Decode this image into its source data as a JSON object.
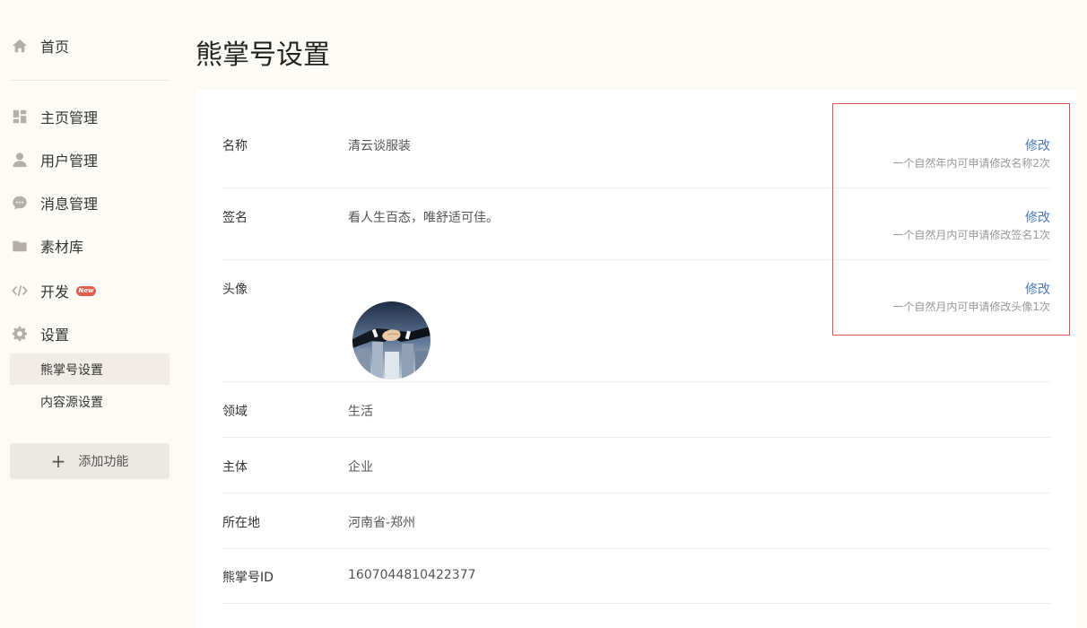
{
  "sidebar": {
    "home": {
      "label": "首页",
      "icon": "home-icon"
    },
    "items": [
      {
        "label": "主页管理",
        "icon": "dashboard-icon"
      },
      {
        "label": "用户管理",
        "icon": "user-icon"
      },
      {
        "label": "消息管理",
        "icon": "chat-icon"
      },
      {
        "label": "素材库",
        "icon": "folder-icon"
      },
      {
        "label": "开发",
        "icon": "code-icon",
        "badge": "New"
      },
      {
        "label": "设置",
        "icon": "gear-icon"
      }
    ],
    "sub_items": [
      {
        "label": "熊掌号设置",
        "active": true
      },
      {
        "label": "内容源设置",
        "active": false
      }
    ],
    "add_button": "添加功能"
  },
  "page": {
    "title": "熊掌号设置"
  },
  "settings": {
    "name": {
      "label": "名称",
      "value": "清云谈服装",
      "edit": "修改",
      "hint": "一个自然年内可申请修改名称2次"
    },
    "signature": {
      "label": "签名",
      "value": "看人生百态，唯舒适可佳。",
      "edit": "修改",
      "hint": "一个自然月内可申请修改签名1次"
    },
    "avatar": {
      "label": "头像",
      "edit": "修改",
      "hint": "一个自然月内可申请修改头像1次"
    },
    "domain": {
      "label": "领域",
      "value": "生活"
    },
    "entity": {
      "label": "主体",
      "value": "企业"
    },
    "location": {
      "label": "所在地",
      "value": "河南省-郑州"
    },
    "xzh_id": {
      "label": "熊掌号ID",
      "value": "1607044810422377"
    }
  },
  "colors": {
    "accent": "#4a79c9",
    "highlight_border": "#d9534f",
    "badge": "#e35b4d"
  }
}
